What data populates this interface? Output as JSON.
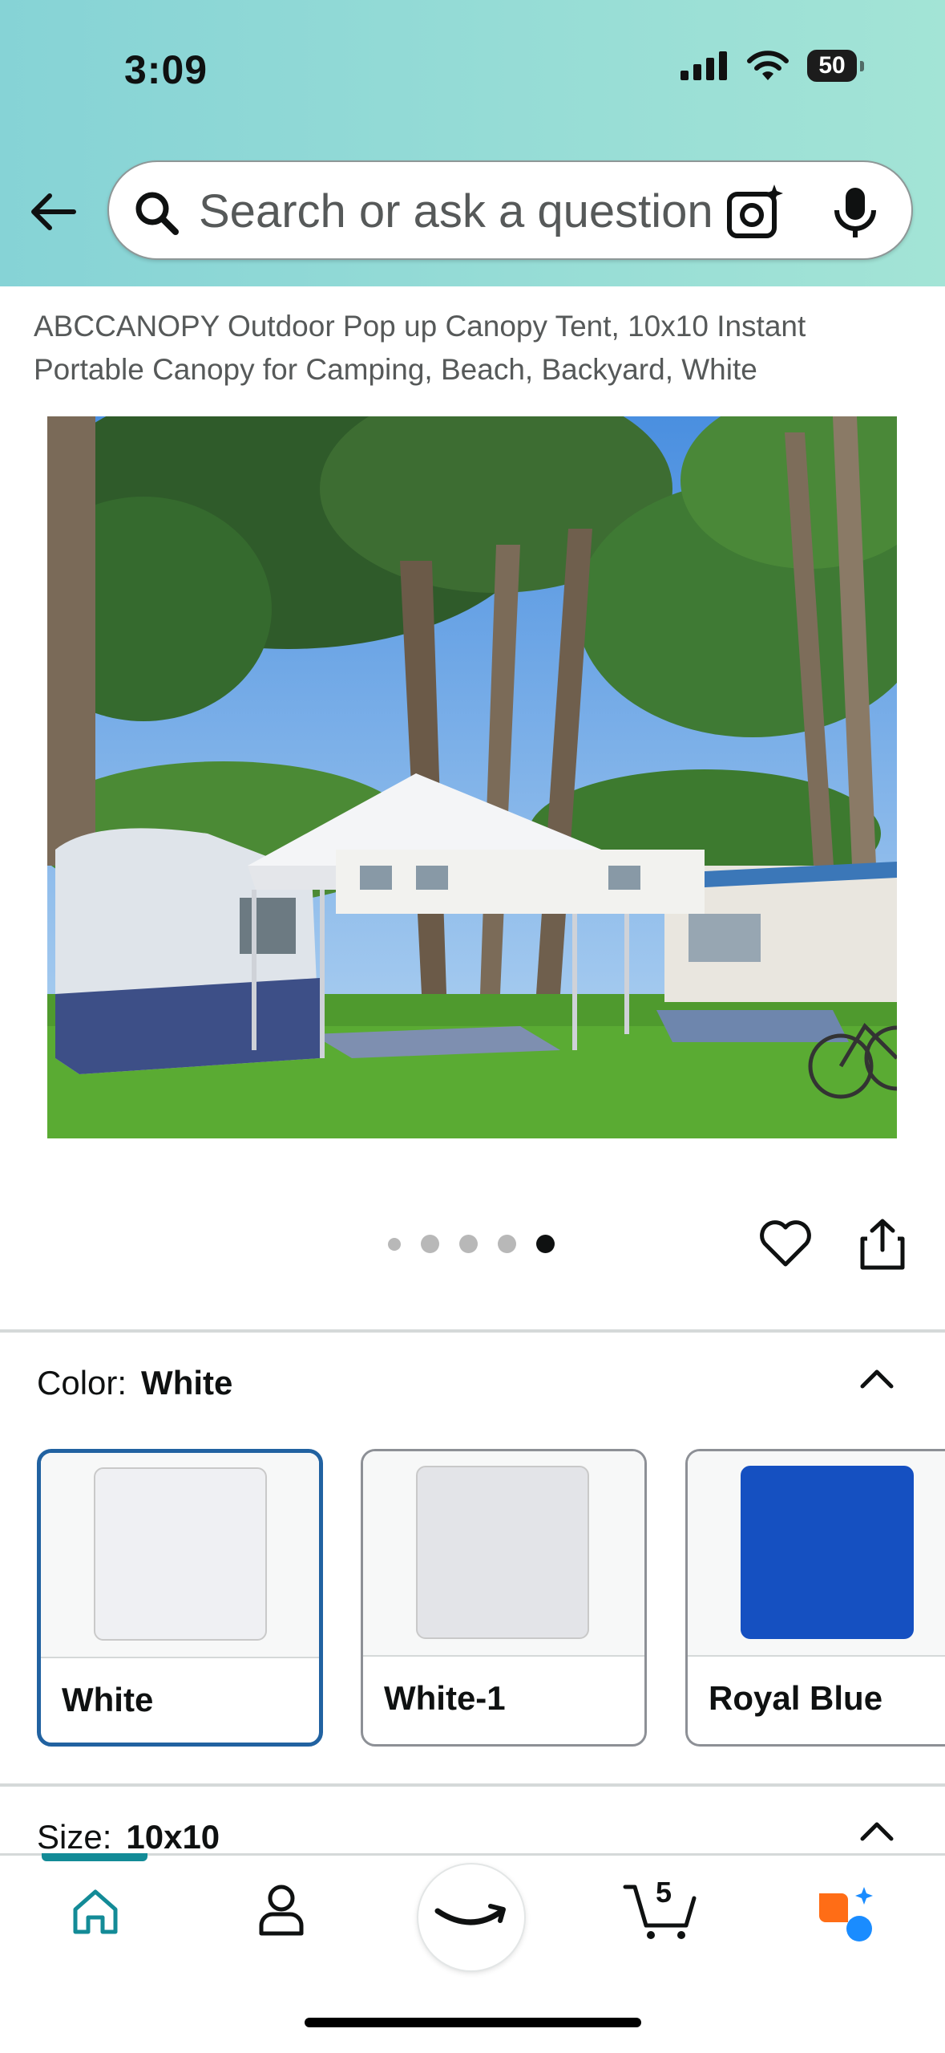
{
  "status": {
    "time": "3:09",
    "battery": "50"
  },
  "search": {
    "placeholder": "Search or ask a question"
  },
  "product": {
    "title": "ABCCANOPY Outdoor Pop up Canopy Tent, 10x10 Instant Portable Canopy for Camping, Beach, Backyard, White",
    "image_count": 5,
    "active_image_index": 4
  },
  "color_section": {
    "label": "Color:",
    "selected": "White",
    "options": [
      {
        "name": "White",
        "swatch": "#eff0f3",
        "selected": true
      },
      {
        "name": "White-1",
        "swatch": "#e3e4e8",
        "selected": false
      },
      {
        "name": "Royal Blue",
        "swatch": "#1550c1",
        "selected": false
      }
    ]
  },
  "size_section": {
    "label": "Size:",
    "selected": "10x10"
  },
  "tabbar": {
    "cart_count": "5"
  },
  "colors": {
    "accent_teal": "#138b97",
    "selected_border": "#2162a1"
  }
}
